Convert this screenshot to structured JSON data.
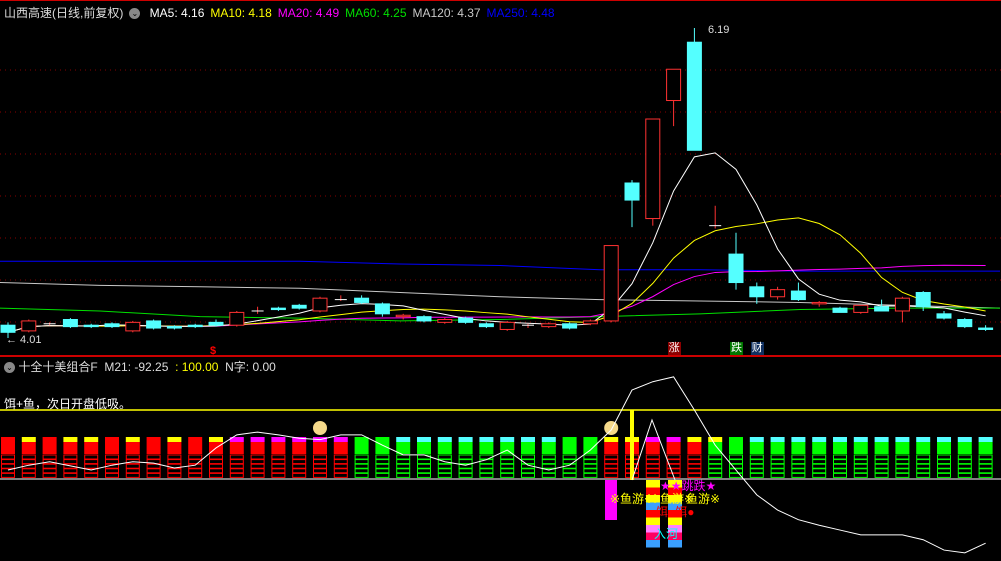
{
  "header": {
    "title": "山西高速(日线,前复权)",
    "ma": [
      {
        "label": "MA5: 4.16",
        "color": "#ffffff"
      },
      {
        "label": "MA10: 4.18",
        "color": "#ffff00"
      },
      {
        "label": "MA20: 4.49",
        "color": "#ff00ff"
      },
      {
        "label": "MA60: 4.25",
        "color": "#00e000"
      },
      {
        "label": "MA120: 4.37",
        "color": "#c8c8c8"
      },
      {
        "label": "MA250: 4.48",
        "color": "#0000ff"
      }
    ]
  },
  "price": {
    "high_label": "6.19",
    "low_label": "4.01",
    "ylim": [
      4.01,
      6.19
    ],
    "candles": [
      [
        4.1,
        4.12,
        4.01,
        4.05
      ],
      [
        4.06,
        4.14,
        4.05,
        4.13
      ],
      [
        4.11,
        4.12,
        4.1,
        4.11
      ],
      [
        4.14,
        4.15,
        4.08,
        4.09
      ],
      [
        4.1,
        4.11,
        4.08,
        4.09
      ],
      [
        4.11,
        4.12,
        4.08,
        4.09
      ],
      [
        4.06,
        4.13,
        4.05,
        4.12
      ],
      [
        4.13,
        4.14,
        4.07,
        4.08
      ],
      [
        4.09,
        4.1,
        4.07,
        4.08
      ],
      [
        4.1,
        4.11,
        4.08,
        4.09
      ],
      [
        4.12,
        4.14,
        4.09,
        4.1
      ],
      [
        4.1,
        4.2,
        4.09,
        4.19
      ],
      [
        4.2,
        4.23,
        4.18,
        4.2
      ],
      [
        4.22,
        4.23,
        4.2,
        4.21
      ],
      [
        4.24,
        4.25,
        4.21,
        4.22
      ],
      [
        4.2,
        4.3,
        4.19,
        4.29
      ],
      [
        4.28,
        4.31,
        4.27,
        4.28
      ],
      [
        4.29,
        4.31,
        4.25,
        4.26
      ],
      [
        4.25,
        4.26,
        4.16,
        4.18
      ],
      [
        4.16,
        4.18,
        4.14,
        4.17
      ],
      [
        4.16,
        4.17,
        4.12,
        4.13
      ],
      [
        4.12,
        4.15,
        4.11,
        4.14
      ],
      [
        4.15,
        4.16,
        4.11,
        4.12
      ],
      [
        4.11,
        4.12,
        4.08,
        4.09
      ],
      [
        4.07,
        4.13,
        4.06,
        4.12
      ],
      [
        4.1,
        4.11,
        4.08,
        4.1
      ],
      [
        4.09,
        4.12,
        4.08,
        4.11
      ],
      [
        4.11,
        4.12,
        4.07,
        4.08
      ],
      [
        4.11,
        4.14,
        4.1,
        4.13
      ],
      [
        4.13,
        4.66,
        4.12,
        4.66
      ],
      [
        5.1,
        5.12,
        4.79,
        4.98
      ],
      [
        4.85,
        5.55,
        4.8,
        5.55
      ],
      [
        5.68,
        5.9,
        5.5,
        5.9
      ],
      [
        6.09,
        6.19,
        5.33,
        5.33
      ],
      [
        4.8,
        4.94,
        4.78,
        4.8
      ],
      [
        4.6,
        4.75,
        4.35,
        4.4
      ],
      [
        4.37,
        4.4,
        4.25,
        4.3
      ],
      [
        4.3,
        4.37,
        4.28,
        4.35
      ],
      [
        4.34,
        4.4,
        4.27,
        4.28
      ],
      [
        4.25,
        4.27,
        4.23,
        4.26
      ],
      [
        4.22,
        4.23,
        4.19,
        4.19
      ],
      [
        4.19,
        4.24,
        4.18,
        4.24
      ],
      [
        4.23,
        4.28,
        4.21,
        4.2
      ],
      [
        4.2,
        4.3,
        4.12,
        4.29
      ],
      [
        4.33,
        4.34,
        4.2,
        4.23
      ],
      [
        4.18,
        4.2,
        4.14,
        4.15
      ],
      [
        4.14,
        4.15,
        4.08,
        4.09
      ],
      [
        4.08,
        4.1,
        4.06,
        4.07
      ]
    ],
    "long_ma": {
      "ma60": [
        4.22,
        4.2,
        4.16,
        4.15,
        4.13,
        4.14,
        4.16,
        4.18,
        4.21,
        4.22,
        4.22
      ],
      "ma120": [
        4.4,
        4.38,
        4.37,
        4.36,
        4.33,
        4.3,
        4.28,
        4.27,
        4.26,
        4.24,
        4.22
      ],
      "ma250": [
        4.55,
        4.55,
        4.55,
        4.55,
        4.53,
        4.52,
        4.49,
        4.49,
        4.48,
        4.48,
        4.48
      ]
    },
    "tags": [
      {
        "text": "涨",
        "bg": "#8b0000",
        "color": "#fff",
        "i": 32
      },
      {
        "text": "跌",
        "bg": "#007700",
        "color": "#fff",
        "i": 35
      },
      {
        "text": "财",
        "bg": "#103060",
        "color": "#fff",
        "i": 36
      }
    ],
    "dollar_mark": "$"
  },
  "indicator": {
    "name": "十全十美组合F",
    "m21": "M21: -92.25",
    "v2": ": 100.00",
    "n": "N字: 0.00",
    "note": "饵+鱼，次日开盘低吸。",
    "signal_left": "※鱼游※",
    "signal_mid": "※鱼游※",
    "signal_right": "鱼游※",
    "star_text": "★★跳跌★",
    "bait_text": "饵●饵●",
    "enter_text": "入河",
    "line": [
      13,
      20,
      25,
      19,
      13,
      20,
      25,
      23,
      16,
      20,
      45,
      64,
      68,
      64,
      59,
      57,
      64,
      64,
      49,
      35,
      35,
      25,
      20,
      28,
      42,
      20,
      13,
      20,
      42,
      71,
      129,
      141,
      148,
      100,
      49,
      13,
      -23,
      -45,
      -59,
      -67,
      -74,
      -81,
      -81,
      -81,
      -88,
      -103,
      -107,
      -93
    ],
    "columns": "RRRRRRRRRRRMMMMMMGGGGGGGGGGGGMMMMMGGGGGGGGGGGGGG",
    "caps": "RYRYYRYRYRYMMMMMMGGCCCCCCCCGGYYMMYYGCCCCCCCCCCCC"
  }
}
